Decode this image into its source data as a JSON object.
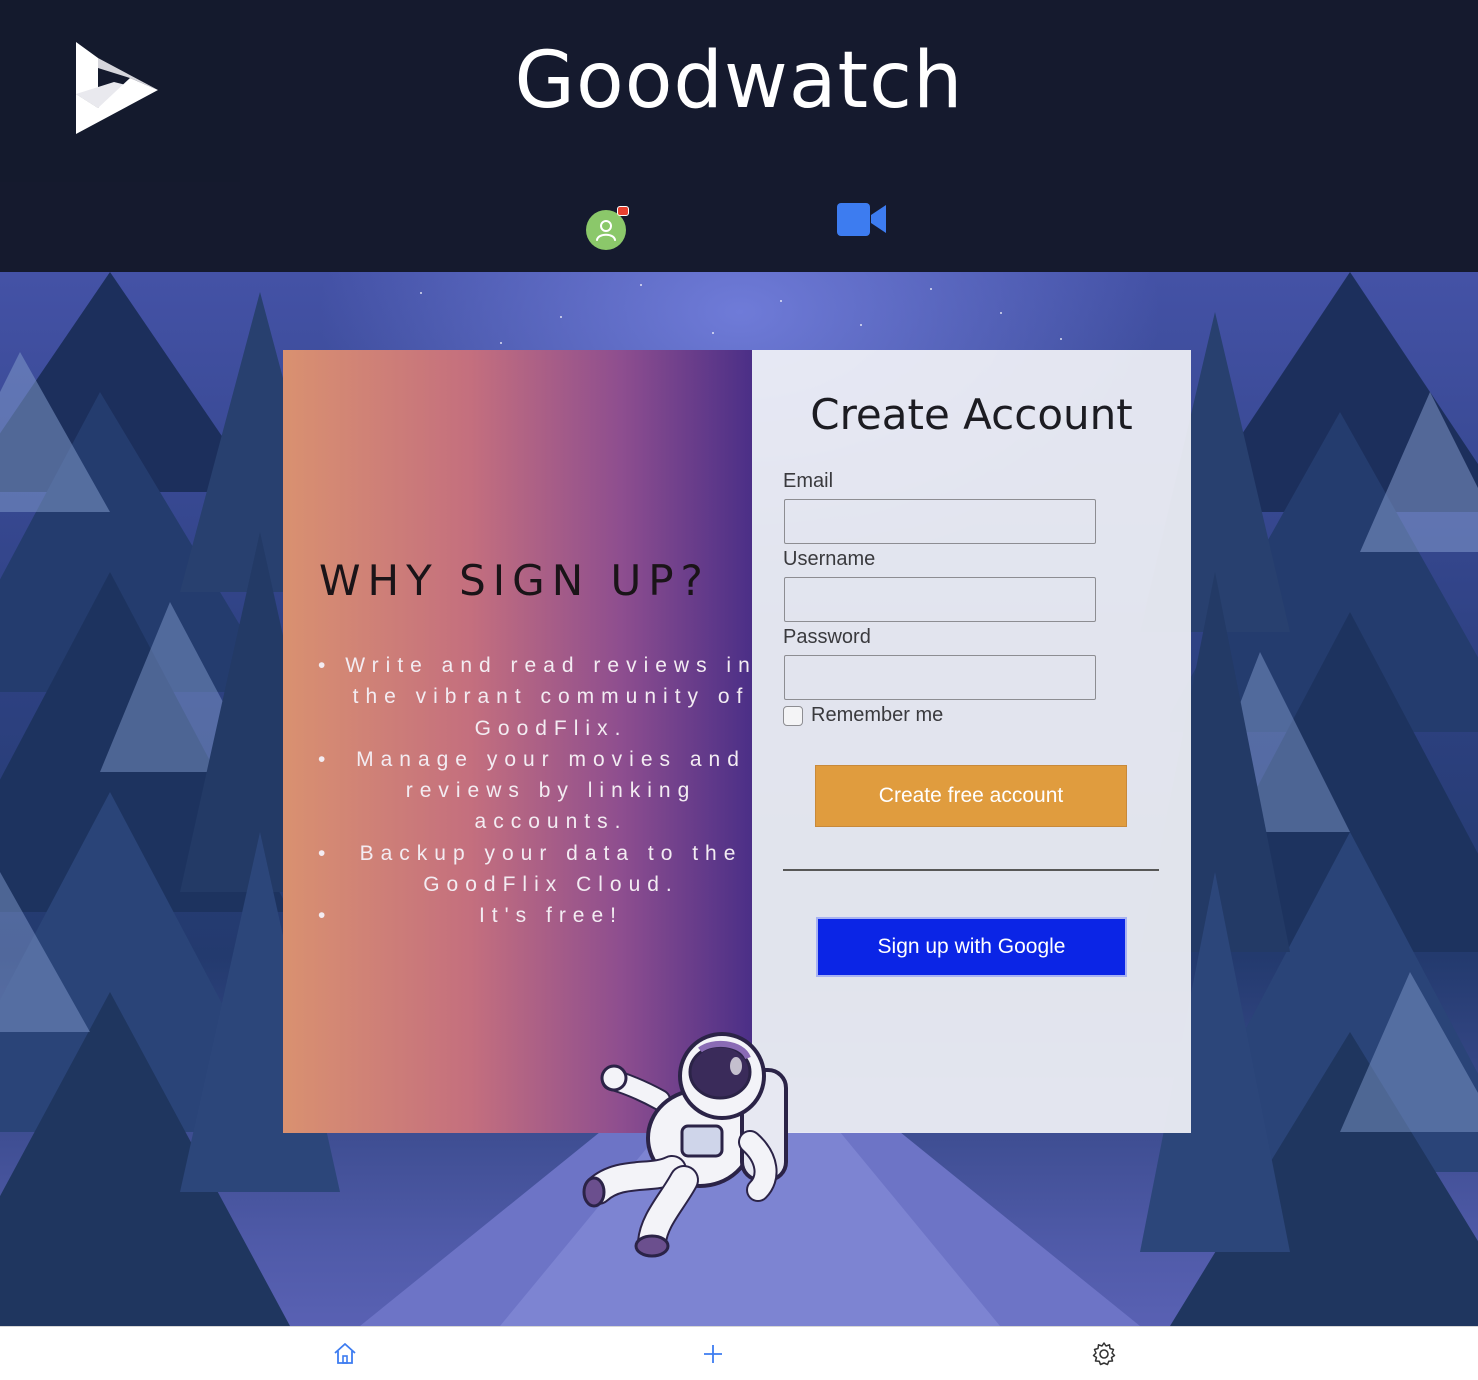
{
  "header": {
    "app_title": "Goodwatch",
    "logo_icon": "play-logo-icon",
    "account_icon": "user-avatar-icon",
    "camera_icon": "video-camera-icon",
    "notification_color": "#e8402f",
    "avatar_color": "#8bc86a",
    "camera_color": "#3d7cf0"
  },
  "benefits_panel": {
    "title": "WHY SIGN UP?",
    "items": [
      "Write and read reviews in the vibrant community of GoodFlix.",
      "Manage your movies and reviews by linking accounts.",
      "Backup your data to the GoodFlix Cloud.",
      "It's free!"
    ]
  },
  "signup_form": {
    "title": "Create Account",
    "email_label": "Email",
    "email_value": "",
    "username_label": "Username",
    "username_value": "",
    "password_label": "Password",
    "password_value": "",
    "remember_label": "Remember me",
    "remember_checked": false,
    "create_button": "Create free account",
    "google_button": "Sign up with Google",
    "create_color": "#e09c3e",
    "google_color": "#0b25e6"
  },
  "tab_bar": {
    "tabs": [
      {
        "icon": "home-icon"
      },
      {
        "icon": "plus-icon"
      },
      {
        "icon": "gear-icon"
      }
    ],
    "active_color": "#3d7cf0"
  }
}
